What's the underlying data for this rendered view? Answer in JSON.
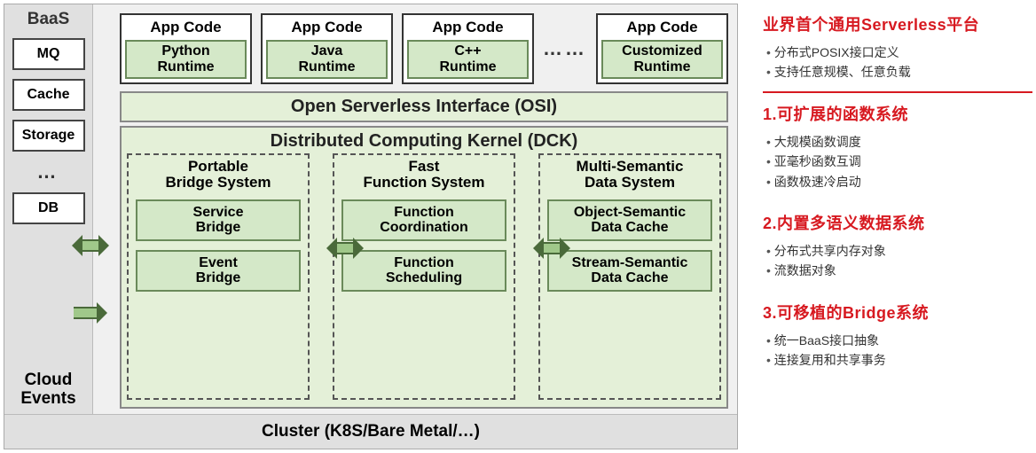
{
  "baas": {
    "title": "BaaS",
    "items": [
      "MQ",
      "Cache",
      "Storage"
    ],
    "dots": "…",
    "db": "DB",
    "cloud_events_l1": "Cloud",
    "cloud_events_l2": "Events"
  },
  "runtimes": {
    "app_code": "App Code",
    "items": [
      "Python\nRuntime",
      "Java\nRuntime",
      "C++\nRuntime"
    ],
    "dots": "……",
    "custom": "Customized\nRuntime"
  },
  "osi": "Open Serverless Interface (OSI)",
  "dck_title": "Distributed Computing Kernel (DCK)",
  "systems": {
    "portable": {
      "title": "Portable\nBridge System",
      "items": [
        "Service\nBridge",
        "Event\nBridge"
      ]
    },
    "fast": {
      "title": "Fast\nFunction System",
      "items": [
        "Function\nCoordination",
        "Function\nScheduling"
      ]
    },
    "multi": {
      "title": "Multi-Semantic\nData System",
      "items": [
        "Object-Semantic\nData Cache",
        "Stream-Semantic\nData Cache"
      ]
    }
  },
  "cluster": "Cluster (K8S/Bare Metal/…)",
  "sidebar": [
    {
      "title": "业界首个通用Serverless平台",
      "bullets": [
        "分布式POSIX接口定义",
        "支持任意规模、任意负载"
      ],
      "redline": true
    },
    {
      "title": "1.可扩展的函数系统",
      "bullets": [
        "大规模函数调度",
        "亚毫秒函数互调",
        "函数极速冷启动"
      ]
    },
    {
      "title": "2.内置多语义数据系统",
      "bullets": [
        "分布式共享内存对象",
        "流数据对象"
      ]
    },
    {
      "title": "3.可移植的Bridge系统",
      "bullets": [
        "统一BaaS接口抽象",
        "连接复用和共享事务"
      ]
    }
  ]
}
